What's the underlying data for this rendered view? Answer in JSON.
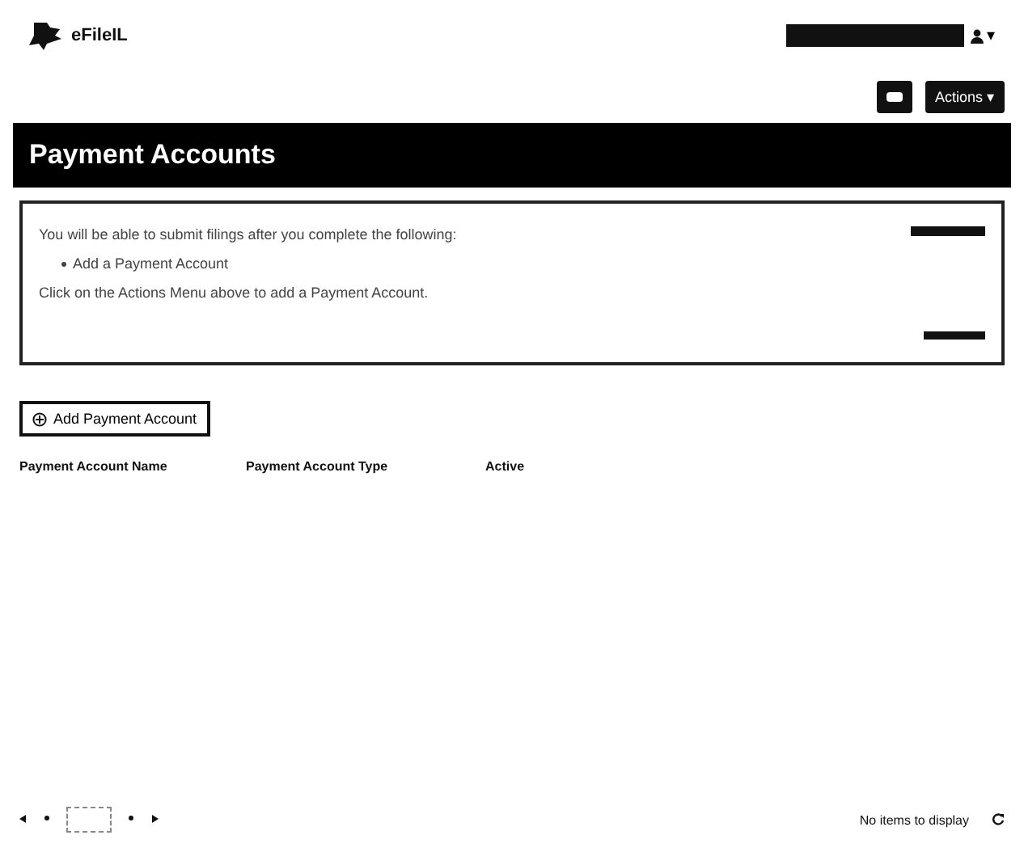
{
  "header": {
    "logo_text": "eFileIL",
    "user_menu": {
      "caret": "▾"
    }
  },
  "toolbar": {
    "actions_button": "Actions ▾"
  },
  "page_title": "Payment Accounts",
  "notice": {
    "lines": [
      {
        "kind": "text",
        "text": "You will be able to submit filings after you complete the following:"
      },
      {
        "kind": "bullet",
        "text": "Add a Payment Account"
      },
      {
        "kind": "text",
        "text": "Click on the Actions Menu above to add a Payment Account."
      }
    ]
  },
  "add_button": "Add Payment Account",
  "table": {
    "columns": [
      "Payment Account Name",
      "Payment Account Type",
      "Active"
    ]
  },
  "pager": {
    "status": "No items to display"
  }
}
